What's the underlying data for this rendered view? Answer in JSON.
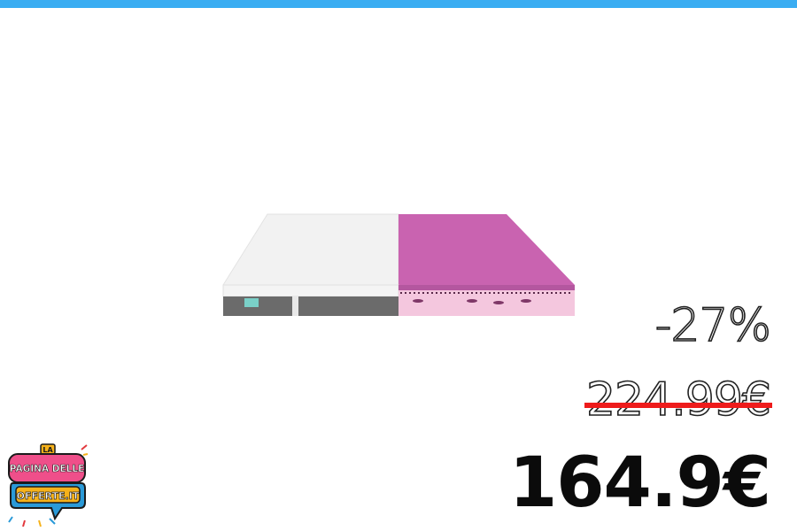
{
  "colors": {
    "top_bar": "#3aadf2",
    "strike": "#ee1b1b",
    "mattress_left": "#f1f1f1",
    "mattress_right": "#c963b0",
    "mattress_right_side": "#f3c7dd",
    "mattress_base": "#6b6b6b"
  },
  "product": {
    "icon": "mattress-image"
  },
  "pricing": {
    "discount": "-27%",
    "old_price": "224.99€",
    "new_price": "164.9€"
  },
  "logo": {
    "line1": "LA",
    "line2": "PAGINA DELLE",
    "line3": "OFFERTE.IT"
  }
}
